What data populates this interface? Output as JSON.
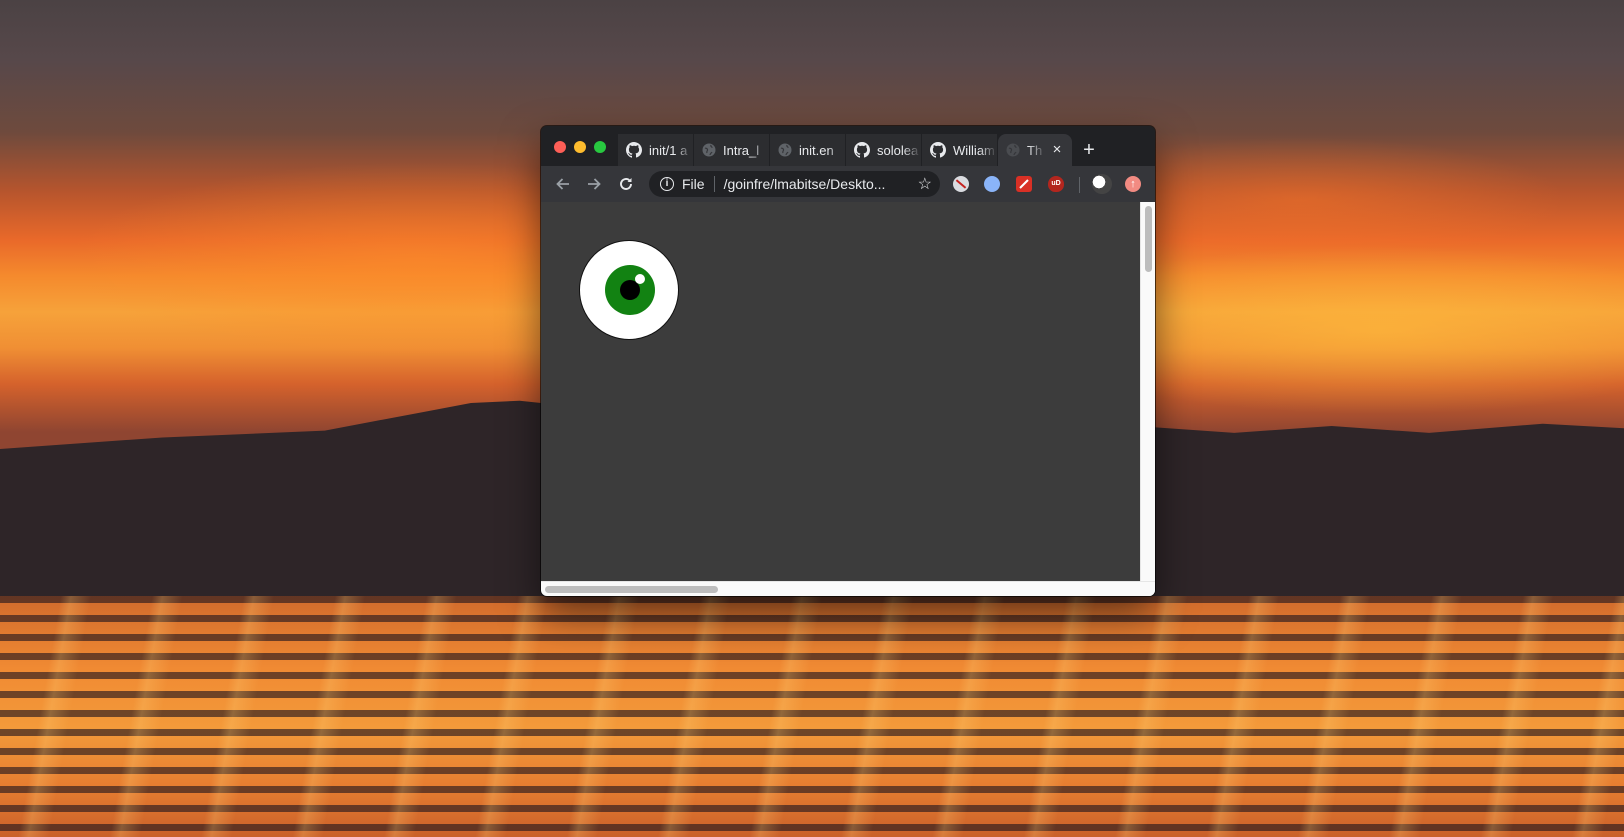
{
  "wallpaper": {
    "name": "sunset-over-lake"
  },
  "browser": {
    "tabs": [
      {
        "title": "init/1 a",
        "icon": "github-icon",
        "active": false
      },
      {
        "title": "Intra_l",
        "icon": "globe-icon",
        "active": false
      },
      {
        "title": "init.en",
        "icon": "globe-icon",
        "active": false
      },
      {
        "title": "sololea",
        "icon": "github-icon",
        "active": false
      },
      {
        "title": "William",
        "icon": "github-icon",
        "active": false
      },
      {
        "title": "Th",
        "icon": "globe-icon",
        "active": true
      }
    ],
    "new_tab_symbol": "+",
    "close_symbol": "×",
    "omnibox": {
      "scheme_label": "File",
      "url": "/goinfre/lmabitse/Deskto..."
    },
    "extensions": [
      "blocked-extension-icon",
      "extension-spy-icon",
      "extension-red-icon",
      "ublock-origin-icon",
      "profile-avatar",
      "extension-pink-icon"
    ],
    "ublock_label": "uD",
    "pink_ext_label": "↑"
  },
  "page": {
    "eye": {
      "sclera_color": "#ffffff",
      "iris_color": "#128212",
      "pupil_color": "#000000",
      "background": "#3c3c3c"
    }
  }
}
